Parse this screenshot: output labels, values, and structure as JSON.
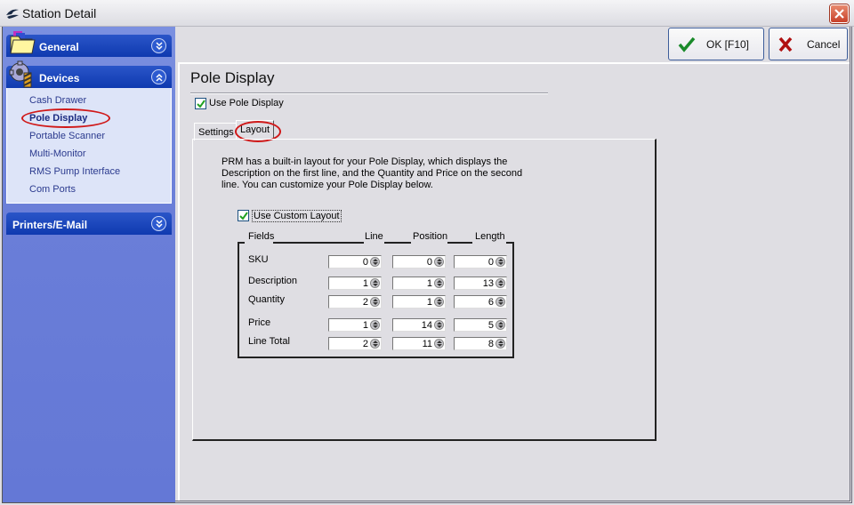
{
  "window": {
    "title": "Station Detail",
    "close_icon": "close-icon"
  },
  "sidebar": {
    "groups": [
      {
        "label": "General",
        "icon": "folder-icon",
        "expanded": false
      },
      {
        "label": "Devices",
        "icon": "gear-device-icon",
        "expanded": true,
        "items": [
          {
            "label": "Cash Drawer",
            "active": false
          },
          {
            "label": "Pole Display",
            "active": true
          },
          {
            "label": "Portable Scanner",
            "active": false
          },
          {
            "label": "Multi-Monitor",
            "active": false
          },
          {
            "label": "RMS Pump Interface",
            "active": false
          },
          {
            "label": "Com Ports",
            "active": false
          }
        ]
      },
      {
        "label": "Printers/E-Mail",
        "expanded": false
      }
    ]
  },
  "toolbar": {
    "ok_label": "OK [F10]",
    "cancel_label": "Cancel"
  },
  "page": {
    "title": "Pole Display",
    "use_pole_display": {
      "label": "Use Pole Display",
      "checked": true
    },
    "tabs": [
      {
        "label": "Settings",
        "active": false
      },
      {
        "label": "Layout",
        "active": true
      }
    ],
    "description": "PRM has a built-in layout for your Pole Display, which displays the Description on the first line, and the Quantity and Price on the second line.  You can customize your Pole Display below.",
    "use_custom_layout": {
      "label": "Use Custom Layout",
      "checked": true
    },
    "layout_table": {
      "headers": {
        "fields": "Fields",
        "line": "Line",
        "position": "Position",
        "length": "Length"
      },
      "rows": [
        {
          "field": "SKU",
          "line": "0",
          "position": "0",
          "length": "0"
        },
        {
          "field": "Description",
          "line": "1",
          "position": "1",
          "length": "13"
        },
        {
          "field": "Quantity",
          "line": "2",
          "position": "1",
          "length": "6"
        },
        {
          "field": "Price",
          "line": "1",
          "position": "14",
          "length": "5"
        },
        {
          "field": "Line Total",
          "line": "2",
          "position": "11",
          "length": "8"
        }
      ]
    }
  },
  "colors": {
    "sidebar_bg": "#6478d6",
    "group_header": "#1a45bc",
    "highlight_ellipse": "#d01818",
    "window_bg": "#dfdee3"
  }
}
